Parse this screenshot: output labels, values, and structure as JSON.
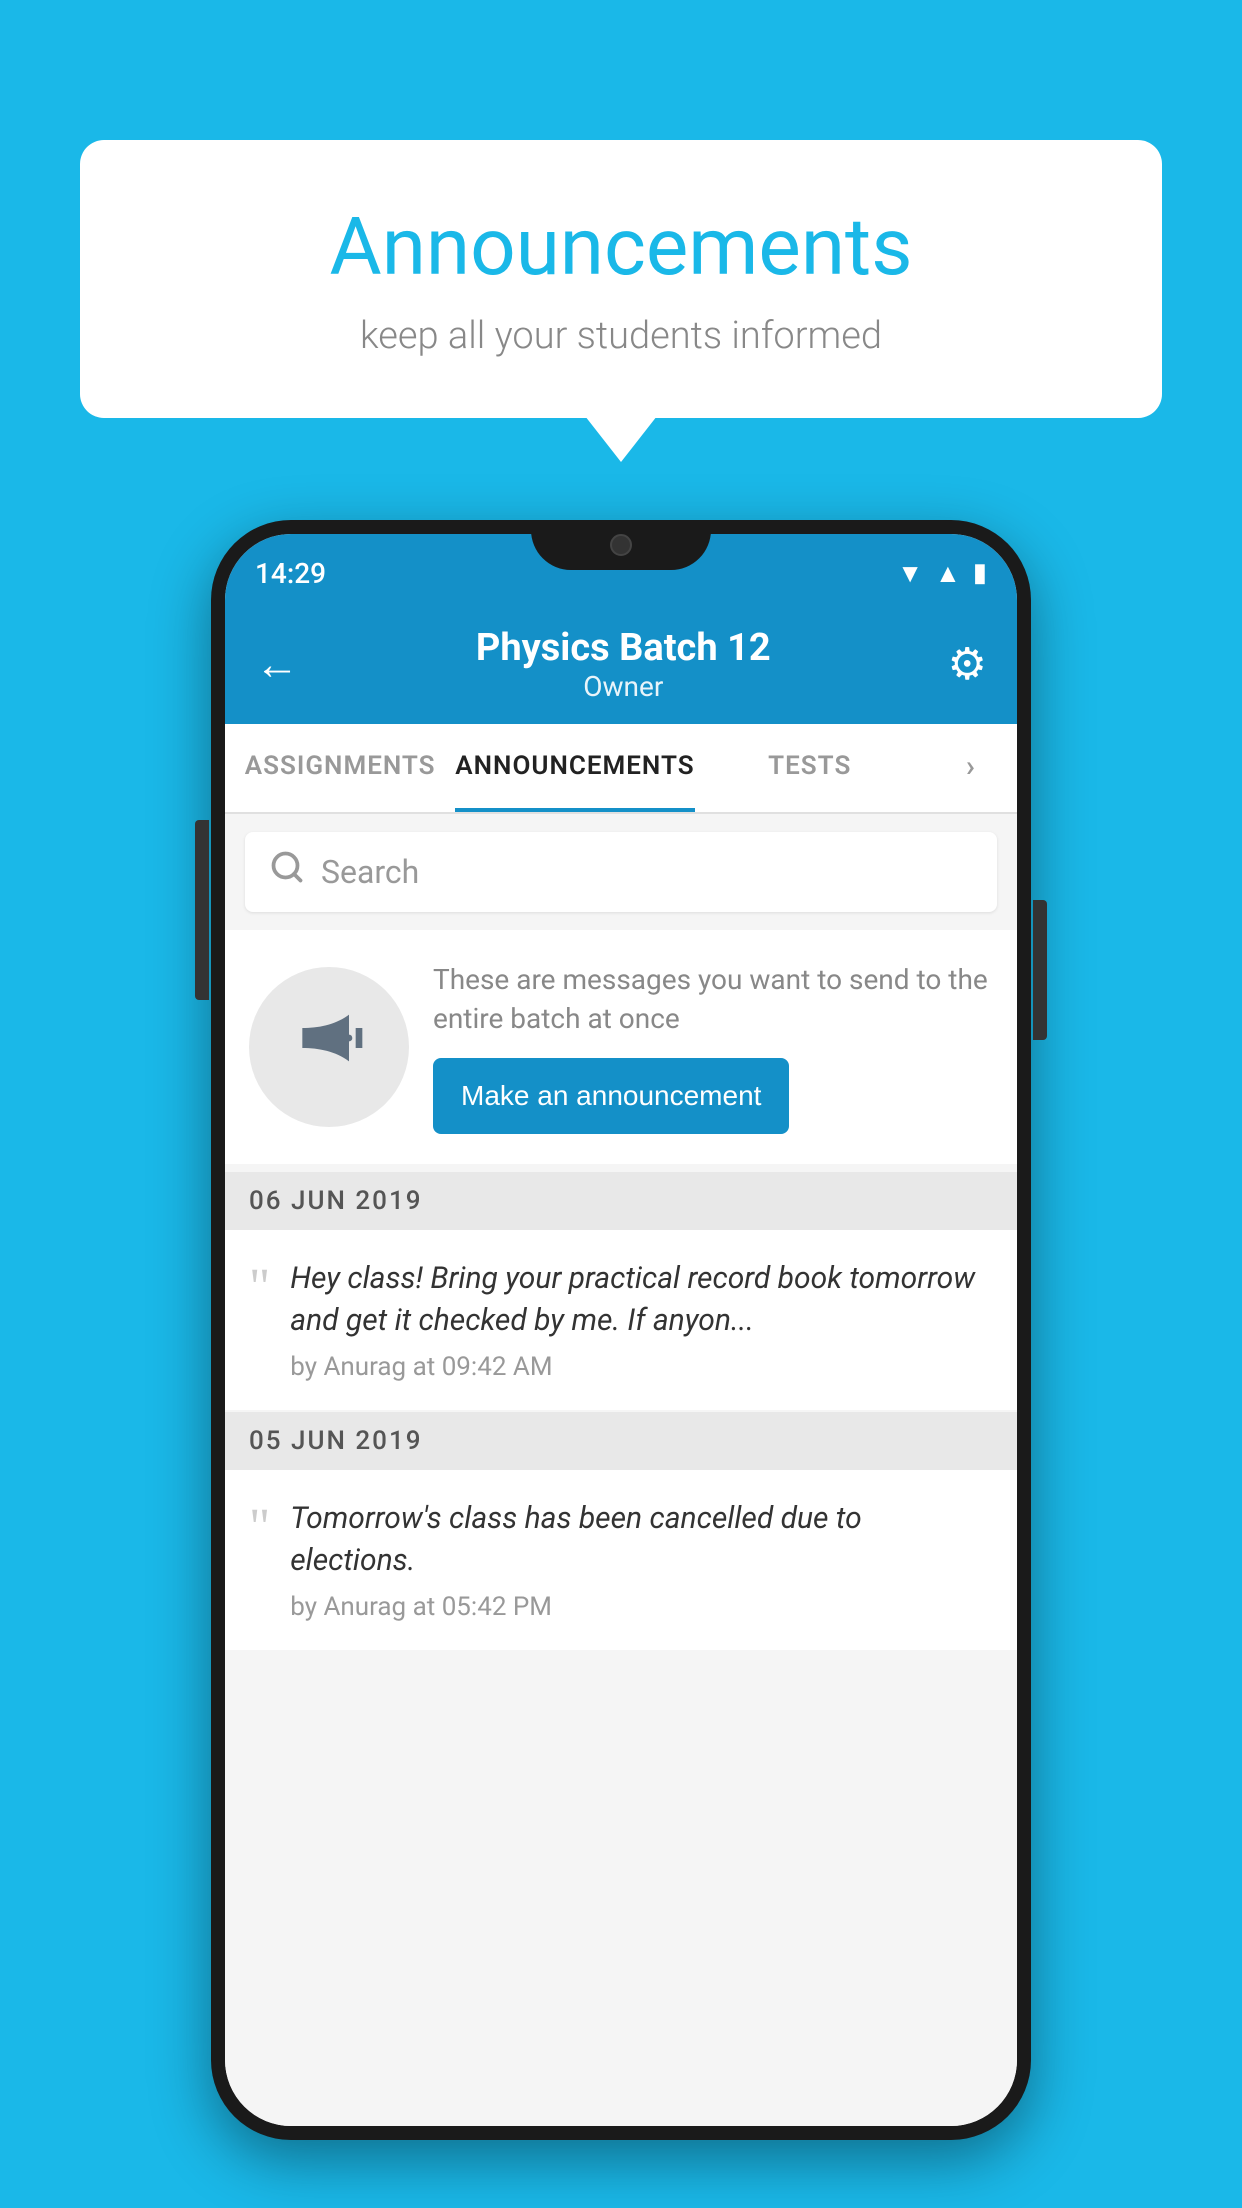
{
  "background_color": "#1ab8e8",
  "speech_bubble": {
    "title": "Announcements",
    "subtitle": "keep all your students informed"
  },
  "phone": {
    "status_bar": {
      "time": "14:29"
    },
    "header": {
      "back_label": "←",
      "batch_name": "Physics Batch 12",
      "role": "Owner",
      "gear_label": "⚙"
    },
    "tabs": [
      {
        "label": "ASSIGNMENTS",
        "active": false
      },
      {
        "label": "ANNOUNCEMENTS",
        "active": true
      },
      {
        "label": "TESTS",
        "active": false
      },
      {
        "label": "›",
        "active": false
      }
    ],
    "search": {
      "placeholder": "Search"
    },
    "announcement_prompt": {
      "description_text": "These are messages you want to send to the entire batch at once",
      "button_label": "Make an announcement"
    },
    "announcements": [
      {
        "date": "06  JUN  2019",
        "text": "Hey class! Bring your practical record book tomorrow and get it checked by me. If anyon...",
        "meta": "by Anurag at 09:42 AM"
      },
      {
        "date": "05  JUN  2019",
        "text": "Tomorrow's class has been cancelled due to elections.",
        "meta": "by Anurag at 05:42 PM"
      }
    ]
  }
}
